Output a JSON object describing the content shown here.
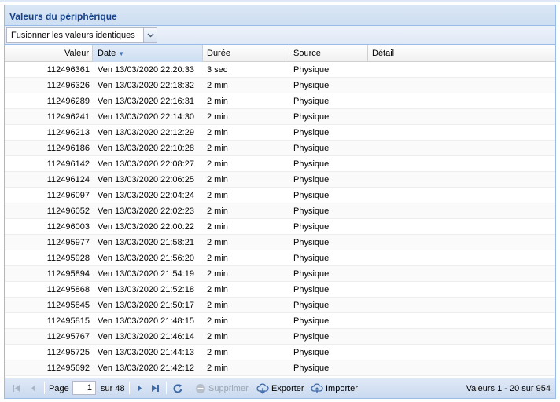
{
  "panel": {
    "title": "Valeurs du périphérique"
  },
  "toolbar": {
    "merge_select": "Fusionner les valeurs identiques"
  },
  "columns": {
    "valeur": "Valeur",
    "date": "Date",
    "duree": "Durée",
    "source": "Source",
    "detail": "Détail"
  },
  "rows": [
    {
      "valeur": "112496361",
      "date": "Ven 13/03/2020 22:20:33",
      "duree": "3 sec",
      "source": "Physique",
      "detail": ""
    },
    {
      "valeur": "112496326",
      "date": "Ven 13/03/2020 22:18:32",
      "duree": "2 min",
      "source": "Physique",
      "detail": ""
    },
    {
      "valeur": "112496289",
      "date": "Ven 13/03/2020 22:16:31",
      "duree": "2 min",
      "source": "Physique",
      "detail": ""
    },
    {
      "valeur": "112496241",
      "date": "Ven 13/03/2020 22:14:30",
      "duree": "2 min",
      "source": "Physique",
      "detail": ""
    },
    {
      "valeur": "112496213",
      "date": "Ven 13/03/2020 22:12:29",
      "duree": "2 min",
      "source": "Physique",
      "detail": ""
    },
    {
      "valeur": "112496186",
      "date": "Ven 13/03/2020 22:10:28",
      "duree": "2 min",
      "source": "Physique",
      "detail": ""
    },
    {
      "valeur": "112496142",
      "date": "Ven 13/03/2020 22:08:27",
      "duree": "2 min",
      "source": "Physique",
      "detail": ""
    },
    {
      "valeur": "112496124",
      "date": "Ven 13/03/2020 22:06:25",
      "duree": "2 min",
      "source": "Physique",
      "detail": ""
    },
    {
      "valeur": "112496097",
      "date": "Ven 13/03/2020 22:04:24",
      "duree": "2 min",
      "source": "Physique",
      "detail": ""
    },
    {
      "valeur": "112496052",
      "date": "Ven 13/03/2020 22:02:23",
      "duree": "2 min",
      "source": "Physique",
      "detail": ""
    },
    {
      "valeur": "112496003",
      "date": "Ven 13/03/2020 22:00:22",
      "duree": "2 min",
      "source": "Physique",
      "detail": ""
    },
    {
      "valeur": "112495977",
      "date": "Ven 13/03/2020 21:58:21",
      "duree": "2 min",
      "source": "Physique",
      "detail": ""
    },
    {
      "valeur": "112495928",
      "date": "Ven 13/03/2020 21:56:20",
      "duree": "2 min",
      "source": "Physique",
      "detail": ""
    },
    {
      "valeur": "112495894",
      "date": "Ven 13/03/2020 21:54:19",
      "duree": "2 min",
      "source": "Physique",
      "detail": ""
    },
    {
      "valeur": "112495868",
      "date": "Ven 13/03/2020 21:52:18",
      "duree": "2 min",
      "source": "Physique",
      "detail": ""
    },
    {
      "valeur": "112495845",
      "date": "Ven 13/03/2020 21:50:17",
      "duree": "2 min",
      "source": "Physique",
      "detail": ""
    },
    {
      "valeur": "112495815",
      "date": "Ven 13/03/2020 21:48:15",
      "duree": "2 min",
      "source": "Physique",
      "detail": ""
    },
    {
      "valeur": "112495767",
      "date": "Ven 13/03/2020 21:46:14",
      "duree": "2 min",
      "source": "Physique",
      "detail": ""
    },
    {
      "valeur": "112495725",
      "date": "Ven 13/03/2020 21:44:13",
      "duree": "2 min",
      "source": "Physique",
      "detail": ""
    },
    {
      "valeur": "112495692",
      "date": "Ven 13/03/2020 21:42:12",
      "duree": "2 min",
      "source": "Physique",
      "detail": ""
    }
  ],
  "pager": {
    "page_label": "Page",
    "page_value": "1",
    "of_label": "sur 48",
    "delete_label": "Supprimer",
    "export_label": "Exporter",
    "import_label": "Importer",
    "status": "Valeurs 1 - 20 sur 954"
  },
  "colors": {
    "title": "#15428b",
    "border": "#99bbe8",
    "accent_icon": "#4a78b8",
    "disabled": "#9aa4b0"
  },
  "icons": [
    "chevron-down-icon",
    "sort-desc-icon",
    "first-page-icon",
    "prev-page-icon",
    "next-page-icon",
    "last-page-icon",
    "refresh-icon",
    "delete-icon",
    "export-icon",
    "import-icon"
  ]
}
